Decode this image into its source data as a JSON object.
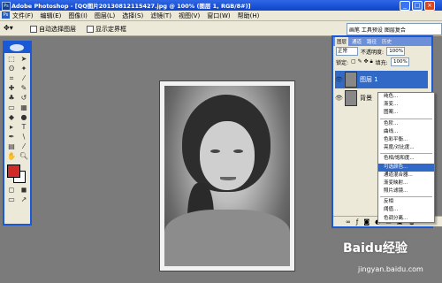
{
  "title_bar": {
    "title": "Adobe Photoshop - [QQ图片20130812115427.jpg @ 100% (图层 1, RGB/8#)]"
  },
  "menu": {
    "items": [
      "文件(F)",
      "编辑(E)",
      "图像(I)",
      "图层(L)",
      "选择(S)",
      "滤镜(T)",
      "视图(V)",
      "窗口(W)",
      "帮助(H)"
    ]
  },
  "options": {
    "auto_select": "自动选择图层",
    "show_bounds": "显示定界框",
    "right_panel": "画笔  工具预设  图层复合"
  },
  "layers_panel": {
    "tabs": [
      "图层",
      "通道",
      "路径",
      "历史"
    ],
    "blend_mode": "正常",
    "opacity_label": "不透明度:",
    "opacity": "100%",
    "lock_label": "锁定:",
    "fill_label": "填充:",
    "fill": "100%",
    "layer1": "图层 1",
    "background": "背景"
  },
  "context_menu": {
    "items": [
      "纯色...",
      "渐变...",
      "图案...",
      "色阶...",
      "曲线...",
      "色彩平衡...",
      "亮度/对比度...",
      "色相/饱和度...",
      "可选颜色...",
      "通道混合器...",
      "渐变映射...",
      "照片滤镜...",
      "反相",
      "阈值...",
      "色调分离..."
    ],
    "highlighted": "可选颜色..."
  },
  "watermark": {
    "brand": "Baidu经验",
    "url": "jingyan.baidu.com"
  },
  "colors": {
    "foreground": "#d02a26",
    "title_blue": "#0d43c8",
    "selection": "#3169c6"
  }
}
